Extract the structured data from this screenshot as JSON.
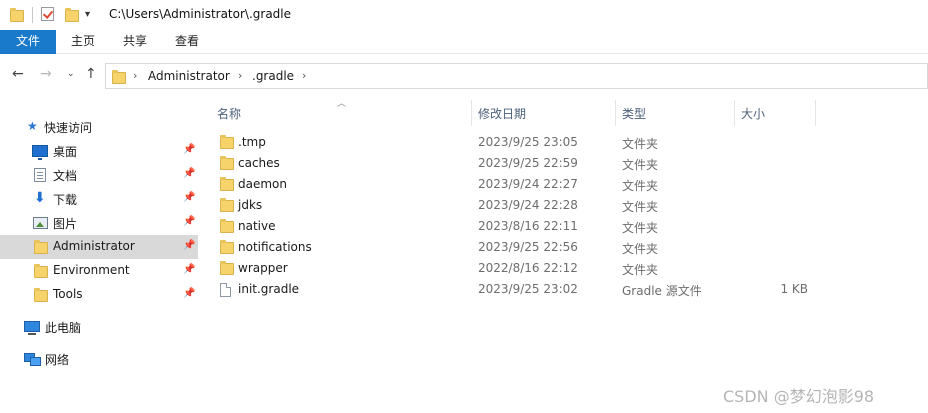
{
  "window": {
    "title": "C:\\Users\\Administrator\\.gradle"
  },
  "ribbon": {
    "tabs": [
      {
        "label": "文件"
      },
      {
        "label": "主页"
      },
      {
        "label": "共享"
      },
      {
        "label": "查看"
      }
    ]
  },
  "nav": {
    "breadcrumb": [
      "Administrator",
      ".gradle"
    ]
  },
  "sidebar": {
    "quick_access_label": "快速访问",
    "items": [
      {
        "label": "桌面",
        "icon": "desktop-icon",
        "pinned": true
      },
      {
        "label": "文档",
        "icon": "document-icon",
        "pinned": true
      },
      {
        "label": "下载",
        "icon": "download-icon",
        "pinned": true
      },
      {
        "label": "图片",
        "icon": "picture-icon",
        "pinned": true
      },
      {
        "label": "Administrator",
        "icon": "folder-icon",
        "pinned": true,
        "selected": true
      },
      {
        "label": "Environment",
        "icon": "folder-icon",
        "pinned": true
      },
      {
        "label": "Tools",
        "icon": "folder-icon",
        "pinned": true
      }
    ],
    "this_pc_label": "此电脑",
    "network_label": "网络"
  },
  "filelist": {
    "columns": {
      "name": "名称",
      "date": "修改日期",
      "type": "类型",
      "size": "大小"
    },
    "rows": [
      {
        "name": ".tmp",
        "date": "2023/9/25 23:05",
        "type": "文件夹",
        "size": "",
        "icon": "folder-icon"
      },
      {
        "name": "caches",
        "date": "2023/9/25 22:59",
        "type": "文件夹",
        "size": "",
        "icon": "folder-icon"
      },
      {
        "name": "daemon",
        "date": "2023/9/24 22:27",
        "type": "文件夹",
        "size": "",
        "icon": "folder-icon"
      },
      {
        "name": "jdks",
        "date": "2023/9/24 22:28",
        "type": "文件夹",
        "size": "",
        "icon": "folder-icon"
      },
      {
        "name": "native",
        "date": "2023/8/16 22:11",
        "type": "文件夹",
        "size": "",
        "icon": "folder-icon"
      },
      {
        "name": "notifications",
        "date": "2023/9/25 22:56",
        "type": "文件夹",
        "size": "",
        "icon": "folder-icon"
      },
      {
        "name": "wrapper",
        "date": "2022/8/16 22:12",
        "type": "文件夹",
        "size": "",
        "icon": "folder-icon"
      },
      {
        "name": "init.gradle",
        "date": "2023/9/25 23:02",
        "type": "Gradle 源文件",
        "size": "1 KB",
        "icon": "file-icon"
      }
    ]
  },
  "watermark": "CSDN @梦幻泡影98",
  "colors": {
    "accent": "#1979ca",
    "selected_row": "#d9d9d9",
    "folder": "#f6d36b"
  }
}
